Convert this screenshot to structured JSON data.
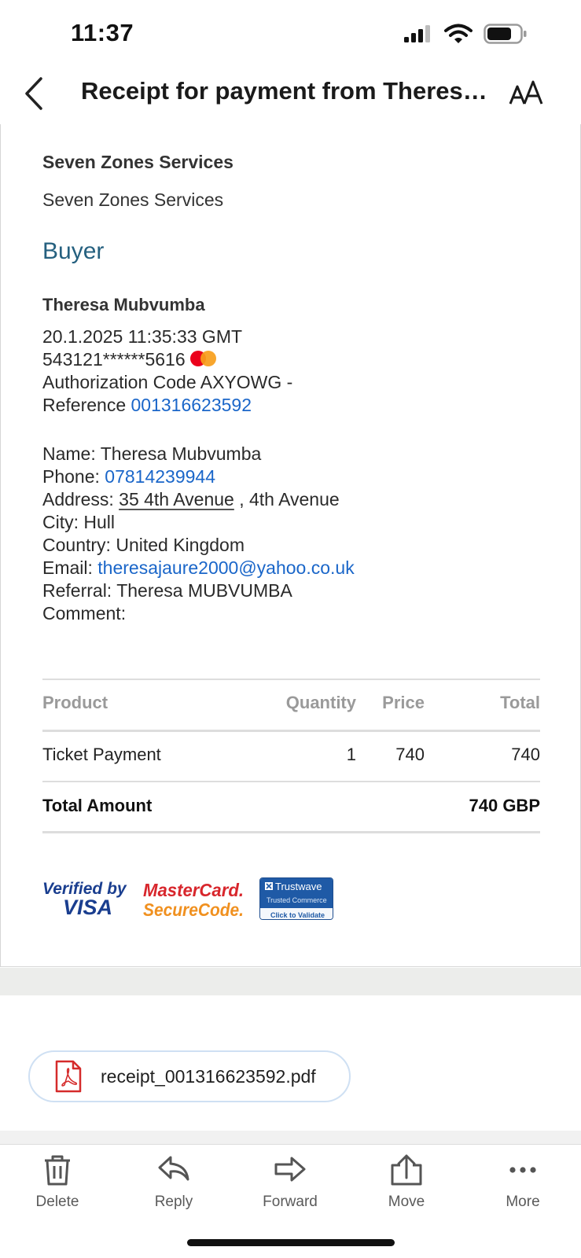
{
  "status_bar": {
    "time": "11:37"
  },
  "nav": {
    "title": "Receipt for payment from Theresa..."
  },
  "merchant": {
    "name_bold": "Seven Zones Services",
    "name": "Seven Zones Services"
  },
  "buyer": {
    "heading": "Buyer",
    "name": "Theresa Mubvumba",
    "datetime": "20.1.2025 11:35:33 GMT",
    "card_number": "543121******5616",
    "card_brand_icon": "mastercard-icon",
    "authorization": "Authorization Code AXYOWG -",
    "reference_label": "Reference",
    "reference_number": "001316623592"
  },
  "details": {
    "name_label": "Name:",
    "name_value": "Theresa Mubvumba",
    "phone_label": "Phone:",
    "phone_value": "07814239944",
    "address_label": "Address:",
    "address_street": "35 4th Avenue",
    "address_rest": ", 4th Avenue",
    "city_label": "City:",
    "city_value": "Hull",
    "country_label": "Country:",
    "country_value": "United Kingdom",
    "email_label": "Email:",
    "email_value": "theresajaure2000@yahoo.co.uk",
    "referral_label": "Referral:",
    "referral_value": "Theresa MUBVUMBA",
    "comment_label": "Comment:"
  },
  "table": {
    "headers": {
      "product": "Product",
      "quantity": "Quantity",
      "price": "Price",
      "total": "Total"
    },
    "rows": [
      {
        "product": "Ticket Payment",
        "quantity": "1",
        "price": "740",
        "total": "740"
      }
    ],
    "total_label": "Total Amount",
    "total_value": "740 GBP"
  },
  "seals": {
    "visa": {
      "line1": "Verified by",
      "line2": "VISA"
    },
    "mastercard": {
      "line1": "MasterCard.",
      "line2": "SecureCode."
    },
    "trustwave": {
      "line1": "Trustwave",
      "line2": "Trusted Commerce",
      "line3": "Click to Validate"
    }
  },
  "attachment": {
    "filename": "receipt_001316623592.pdf",
    "icon": "pdf-file-icon"
  },
  "toolbar": {
    "delete": "Delete",
    "reply": "Reply",
    "forward": "Forward",
    "move": "Move",
    "more": "More"
  },
  "colors": {
    "link": "#1a66c9",
    "heading": "#25607f",
    "mastercard_red": "#eb001b",
    "mastercard_orange": "#f79e1b"
  }
}
